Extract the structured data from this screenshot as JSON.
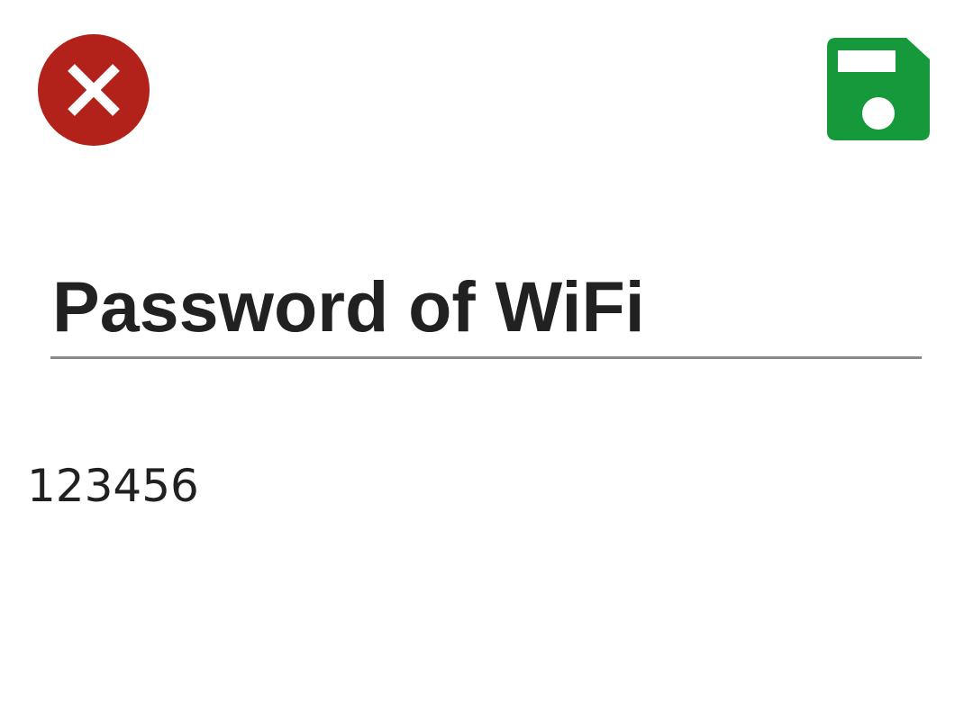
{
  "toolbar": {
    "close_icon": "close-icon",
    "close_color": "#b3211b",
    "save_icon": "save-floppy-icon",
    "save_color": "#15993b"
  },
  "field": {
    "title": "Password of WiFi",
    "value": "123456"
  }
}
